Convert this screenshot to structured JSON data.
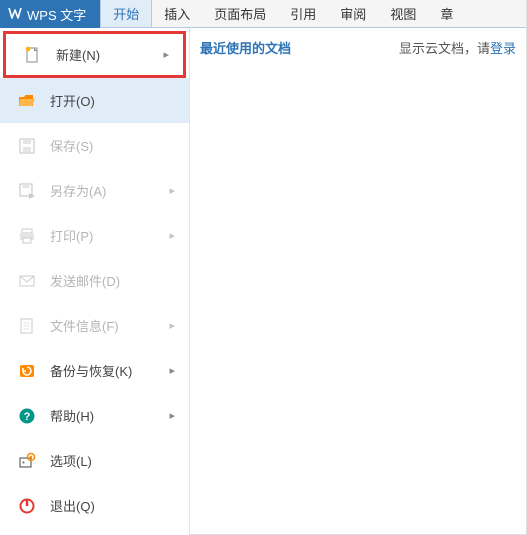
{
  "app": {
    "name": "WPS 文字"
  },
  "tabs": [
    {
      "label": "开始",
      "active": true
    },
    {
      "label": "插入"
    },
    {
      "label": "页面布局"
    },
    {
      "label": "引用"
    },
    {
      "label": "审阅"
    },
    {
      "label": "视图"
    },
    {
      "label": "章"
    }
  ],
  "menu": {
    "new": {
      "label": "新建(N)",
      "disabled": false,
      "chevron": true,
      "highlighted": true
    },
    "open": {
      "label": "打开(O)",
      "disabled": false,
      "chevron": false,
      "selected": true
    },
    "save": {
      "label": "保存(S)",
      "disabled": true,
      "chevron": false
    },
    "saveas": {
      "label": "另存为(A)",
      "disabled": true,
      "chevron": true
    },
    "print": {
      "label": "打印(P)",
      "disabled": true,
      "chevron": true
    },
    "send": {
      "label": "发送邮件(D)",
      "disabled": true,
      "chevron": false
    },
    "info": {
      "label": "文件信息(F)",
      "disabled": true,
      "chevron": true
    },
    "backup": {
      "label": "备份与恢复(K)",
      "disabled": false,
      "chevron": true
    },
    "help": {
      "label": "帮助(H)",
      "disabled": false,
      "chevron": true
    },
    "options": {
      "label": "选项(L)",
      "disabled": false,
      "chevron": false
    },
    "exit": {
      "label": "退出(Q)",
      "disabled": false,
      "chevron": false
    }
  },
  "content": {
    "recent_title": "最近使用的文档",
    "cloud_prefix": "显示云文档，请",
    "cloud_link": "登录"
  },
  "colors": {
    "accent": "#2e74b5",
    "highlight_border": "#e53935",
    "orange": "#ff8a00",
    "teal": "#009688"
  }
}
